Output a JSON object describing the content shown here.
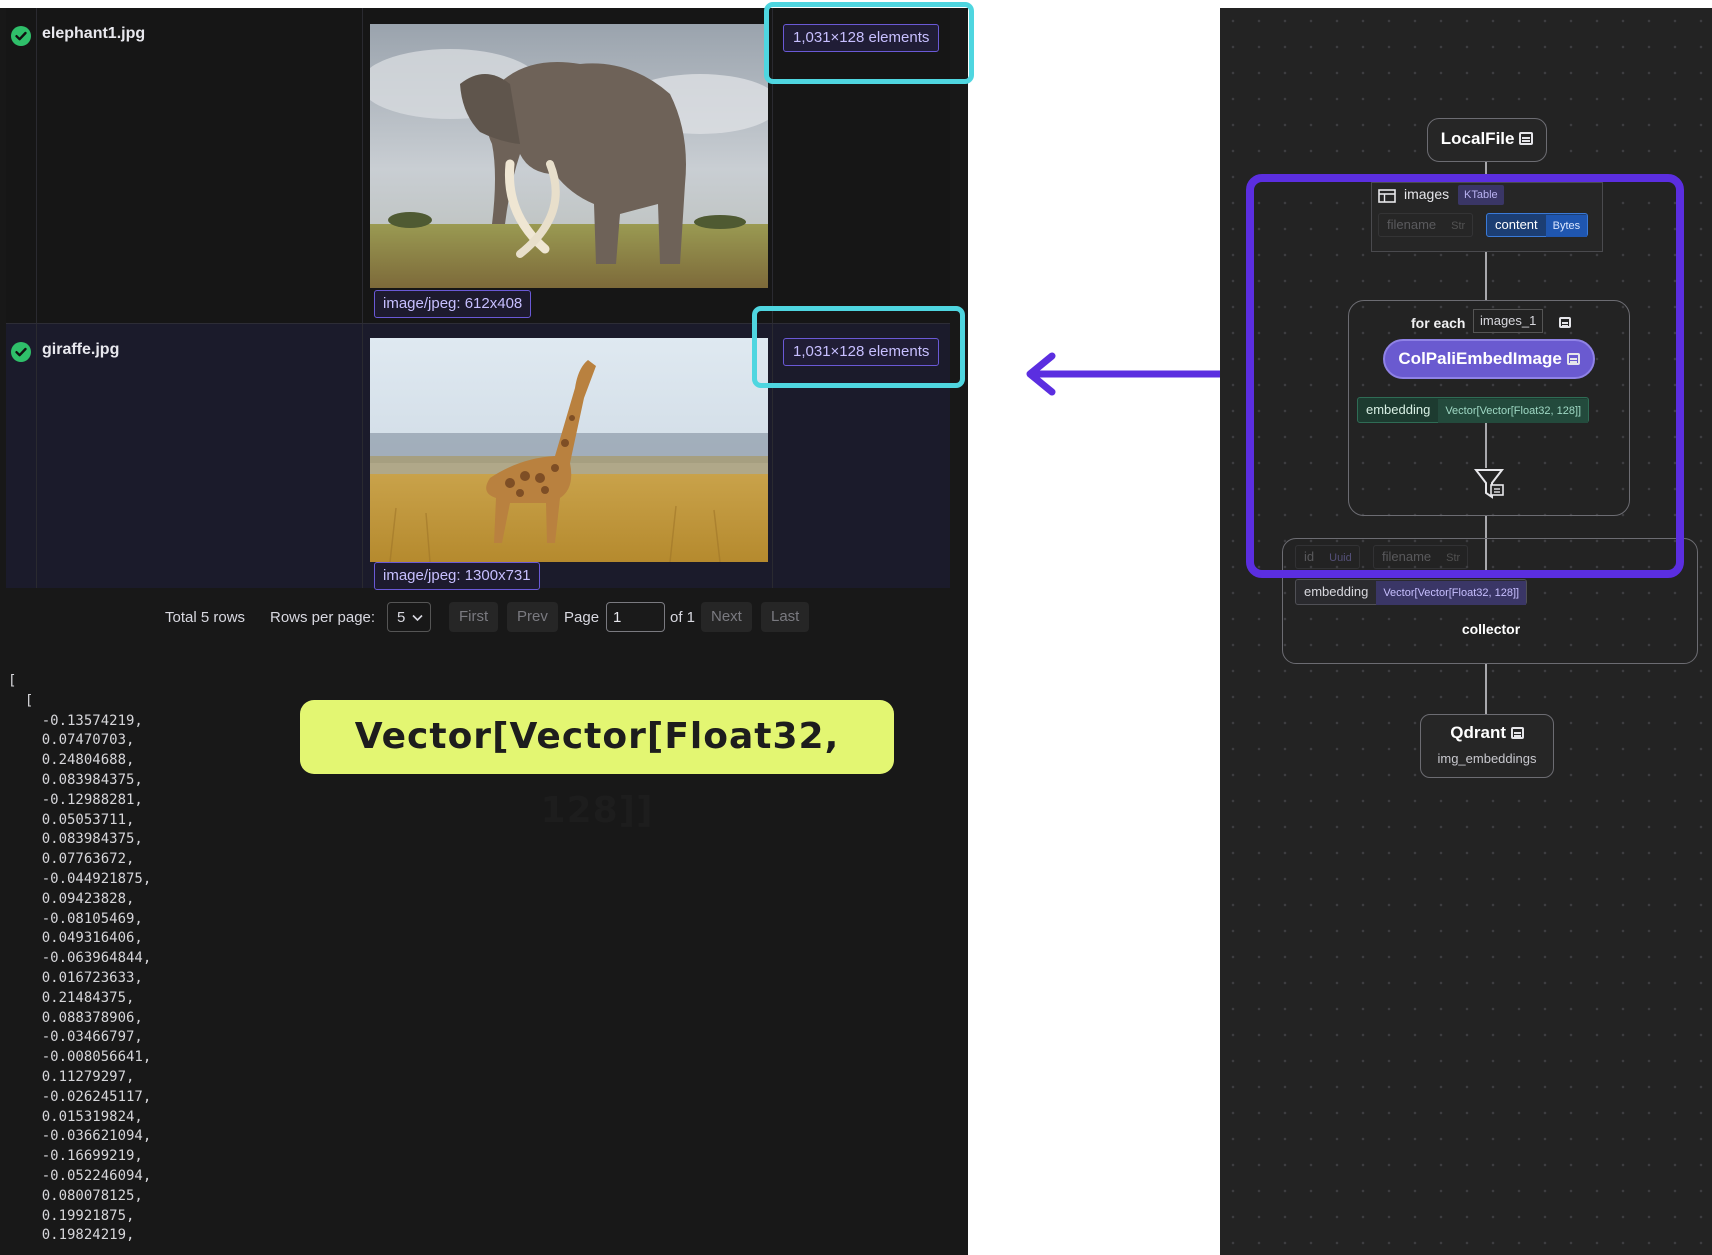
{
  "table": {
    "rows": [
      {
        "status": "success",
        "filename": "elephant1.jpg",
        "mime_label": "image/jpeg: 612x408",
        "embedding_summary": "1,031×128 elements"
      },
      {
        "status": "success",
        "filename": "giraffe.jpg",
        "mime_label": "image/jpeg: 1300x731",
        "embedding_summary": "1,031×128 elements"
      }
    ]
  },
  "pagination": {
    "total_label": "Total 5 rows",
    "rows_per_page_label": "Rows per page:",
    "rows_per_page_value": "5",
    "first": "First",
    "prev": "Prev",
    "page_label": "Page",
    "page_value": "1",
    "of_label": "of 1",
    "next": "Next",
    "last": "Last"
  },
  "json_output": {
    "open_outer": "[",
    "open_inner": "  [",
    "values": [
      "-0.13574219,",
      "0.07470703,",
      "0.24804688,",
      "0.083984375,",
      "-0.12988281,",
      "0.05053711,",
      "0.083984375,",
      "0.07763672,",
      "-0.044921875,",
      "0.09423828,",
      "-0.08105469,",
      "0.049316406,",
      "-0.063964844,",
      "0.016723633,",
      "0.21484375,",
      "0.088378906,",
      "-0.03466797,",
      "-0.008056641,",
      "0.11279297,",
      "-0.026245117,",
      "0.015319824,",
      "-0.036621094,",
      "-0.16699219,",
      "-0.052246094,",
      "0.080078125,",
      "0.19921875,",
      "0.19824219,"
    ]
  },
  "callout": {
    "text": "Vector[Vector[Float32, 128]]"
  },
  "flow": {
    "localfile_node": {
      "title": "LocalFile"
    },
    "images_table": {
      "name": "images",
      "type": "KTable"
    },
    "images_fields": [
      {
        "name": "filename",
        "type": "Str"
      },
      {
        "name": "content",
        "type": "Bytes"
      }
    ],
    "foreach": {
      "label": "for each",
      "target": "images_1"
    },
    "embed_node": {
      "title": "ColPaliEmbedImage"
    },
    "embedding_field": {
      "name": "embedding",
      "type": "Vector[Vector[Float32, 128]]"
    },
    "collector": {
      "fields": [
        {
          "name": "id",
          "type": "Uuid"
        },
        {
          "name": "filename",
          "type": "Str"
        }
      ],
      "embedding_field": {
        "name": "embedding",
        "type": "Vector[Vector[Float32, 128]]"
      },
      "label": "collector"
    },
    "qdrant_node": {
      "title": "Qdrant",
      "subtitle": "img_embeddings"
    }
  },
  "colors": {
    "highlight_cyan": "#4fd6e0",
    "highlight_purple": "#5b2ee0",
    "callout_bg": "#e3f672",
    "embed_node_bg": "#6a5ad0",
    "success_green": "#2fbf6a"
  },
  "icons": [
    "check-circle-icon",
    "table-icon",
    "document-icon",
    "filter-icon",
    "chevron-down-icon",
    "arrow-left-icon"
  ]
}
